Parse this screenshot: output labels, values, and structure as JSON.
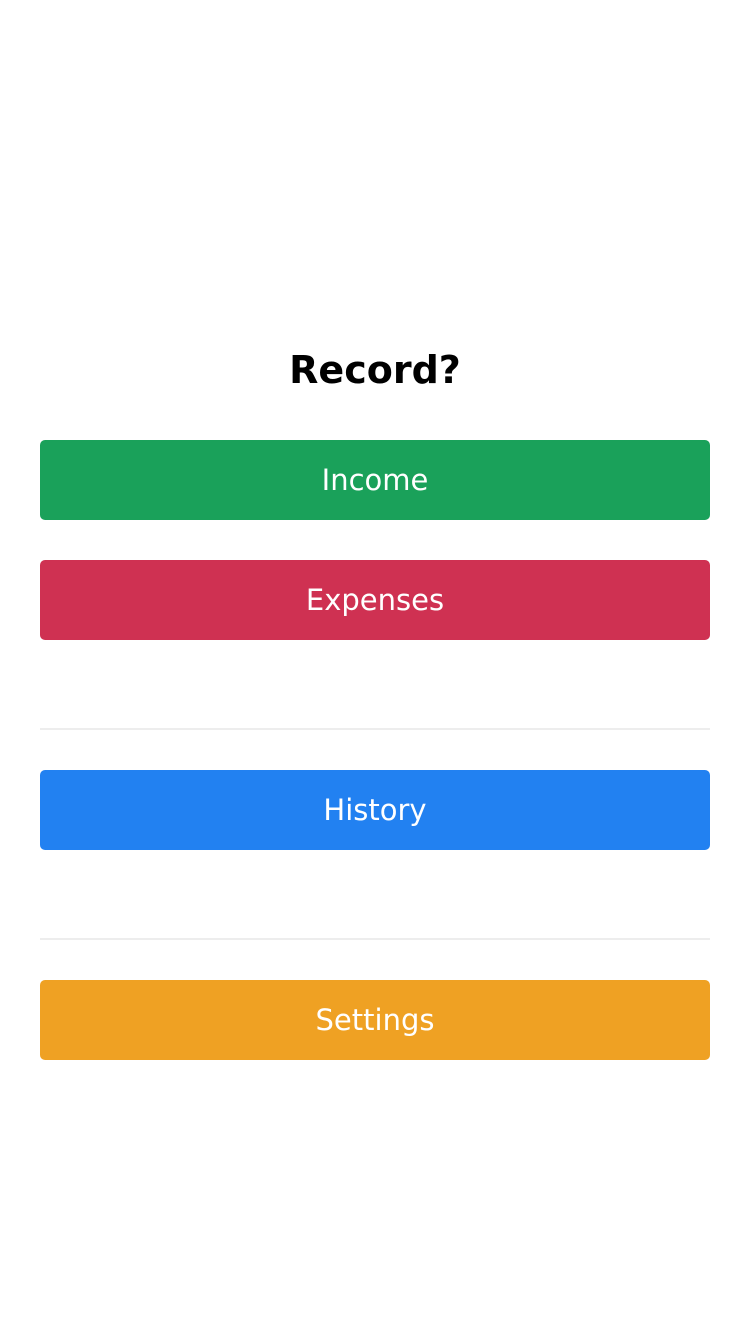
{
  "title": "Record?",
  "buttons": {
    "income": {
      "label": "Income",
      "color": "#1aa15a"
    },
    "expenses": {
      "label": "Expenses",
      "color": "#cf3152"
    },
    "history": {
      "label": "History",
      "color": "#2281f1"
    },
    "settings": {
      "label": "Settings",
      "color": "#efa123"
    }
  },
  "divider_color": "#ededed"
}
